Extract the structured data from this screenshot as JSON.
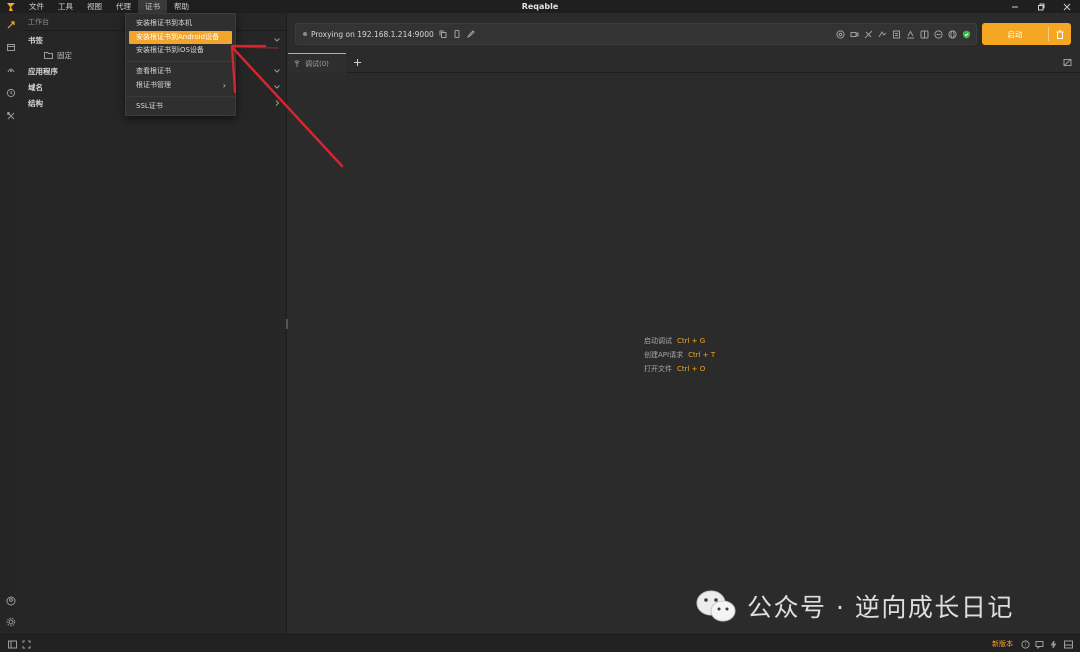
{
  "app": {
    "title": "Reqable"
  },
  "menubar": {
    "items": [
      {
        "label": "文件"
      },
      {
        "label": "工具"
      },
      {
        "label": "视图"
      },
      {
        "label": "代理"
      },
      {
        "label": "证书"
      },
      {
        "label": "帮助"
      }
    ]
  },
  "cert_menu": {
    "items": [
      {
        "label": "安装根证书到本机"
      },
      {
        "label": "安装根证书到Android设备"
      },
      {
        "label": "安装根证书到iOS设备"
      },
      {
        "label": "查看根证书"
      },
      {
        "label": "根证书管理"
      },
      {
        "label": "SSL证书"
      }
    ]
  },
  "sidebar": {
    "header": "工作台",
    "items": [
      {
        "label": "书签"
      },
      {
        "label": "固定"
      },
      {
        "label": "应用程序"
      },
      {
        "label": "域名"
      },
      {
        "label": "结构"
      }
    ]
  },
  "proxy": {
    "status_text": "Proxying on 192.168.1.214:9000"
  },
  "start_button": {
    "label": "启动"
  },
  "tabs": {
    "debug_label": "调试(0)"
  },
  "shortcuts": [
    {
      "label": "启动调试",
      "key": "Ctrl + G"
    },
    {
      "label": "创建API请求",
      "key": "Ctrl + T"
    },
    {
      "label": "打开文件",
      "key": "Ctrl + O"
    }
  ],
  "statusbar": {
    "new_version": "新版本"
  },
  "watermark": {
    "text": "公众号 · 逆向成长日记"
  },
  "colors": {
    "accent": "#f5a623",
    "background": "#2b2b2b",
    "annotation": "#d9262d",
    "shield_green": "#3bb54a"
  }
}
